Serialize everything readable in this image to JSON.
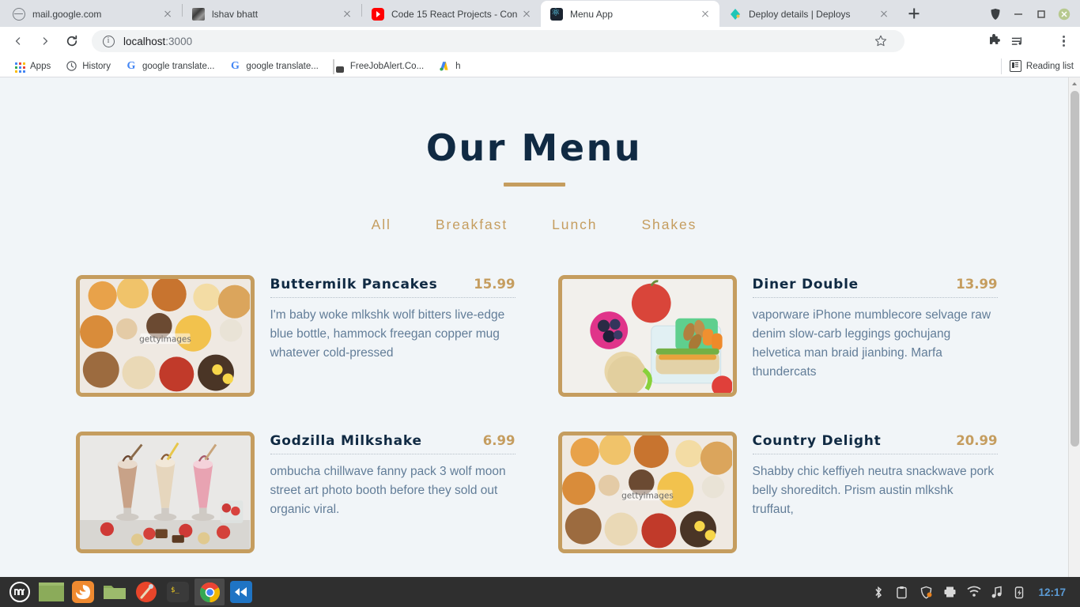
{
  "browser": {
    "tabs": [
      {
        "title": "mail.google.com",
        "icon": "globe-icon",
        "active": false
      },
      {
        "title": "lshav bhatt",
        "icon": "photo-icon",
        "active": false
      },
      {
        "title": "Code 15 React Projects - Con",
        "icon": "youtube-icon",
        "active": false
      },
      {
        "title": "Menu App",
        "icon": "react-icon",
        "active": true
      },
      {
        "title": "Deploy details | Deploys",
        "icon": "netlify-icon",
        "active": false
      }
    ],
    "new_tab_label": "+",
    "window_controls": [
      "shield-icon",
      "minimize",
      "maximize",
      "close"
    ],
    "address": {
      "url_host": "localhost",
      "url_port": ":3000",
      "security_icon": "info-icon"
    },
    "toolbar_icons": [
      "bookmark-star-icon",
      "react-devtools-icon",
      "color-wheel-icon",
      "grammarly-icon",
      "extensions-puzzle-icon",
      "playlist-icon",
      "profile-avatar",
      "chrome-menu-icon"
    ],
    "bookmarks": [
      {
        "label": "Apps",
        "icon": "apps-grid-icon"
      },
      {
        "label": "History",
        "icon": "history-clock-icon"
      },
      {
        "label": "google translate...",
        "icon": "google-icon"
      },
      {
        "label": "google translate...",
        "icon": "google-icon"
      },
      {
        "label": "FreeJobAlert.Co...",
        "icon": "freejobalert-icon"
      },
      {
        "label": "h",
        "icon": "google-ads-icon"
      }
    ],
    "reading_list": {
      "label": "Reading list",
      "icon": "reading-list-icon"
    }
  },
  "page": {
    "title": "Our Menu",
    "filters": [
      {
        "label": "All"
      },
      {
        "label": "Breakfast"
      },
      {
        "label": "Lunch"
      },
      {
        "label": "Shakes"
      }
    ],
    "items": [
      {
        "name": "Buttermilk Pancakes",
        "price": "15.99",
        "desc": "I'm baby woke mlkshk wolf bitters live-edge blue bottle, hammock freegan copper mug whatever cold-pressed",
        "image": "breakfast-spread-photo"
      },
      {
        "name": "Diner Double",
        "price": "13.99",
        "desc": "vaporware iPhone mumblecore selvage raw denim slow-carb leggings gochujang helvetica man braid jianbing. Marfa thundercats",
        "image": "lunch-box-photo"
      },
      {
        "name": "Godzilla Milkshake",
        "price": "6.99",
        "desc": "ombucha chillwave fanny pack 3 wolf moon street art photo booth before they sold out organic viral.",
        "image": "milkshakes-photo"
      },
      {
        "name": "Country Delight",
        "price": "20.99",
        "desc": "Shabby chic keffiyeh neutra snackwave pork belly shoreditch. Prism austin mlkshk truffaut,",
        "image": "breakfast-spread-photo"
      }
    ],
    "colors": {
      "background": "#f1f5f8",
      "heading": "#102a43",
      "accent": "#c59d5f",
      "description": "#627d98"
    }
  },
  "taskbar": {
    "apps": [
      "mint-menu-icon",
      "window-icon",
      "firefox-icon",
      "files-icon",
      "redshift-icon",
      "terminal-icon",
      "chrome-icon",
      "vscode-icon"
    ],
    "tray": [
      "bluetooth-icon",
      "clipboard-icon",
      "shield-icon",
      "printer-icon",
      "wifi-icon",
      "music-note-icon",
      "battery-charging-icon"
    ],
    "clock": "12:17"
  }
}
